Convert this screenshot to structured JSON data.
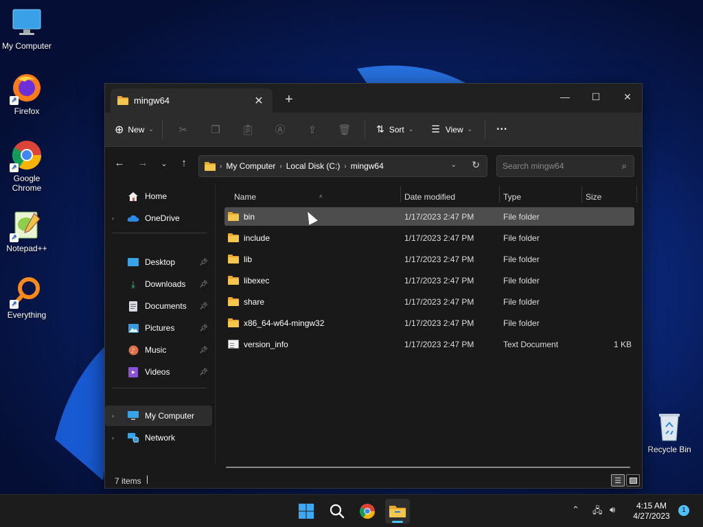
{
  "desktop": {
    "icons": [
      {
        "label": "My Computer"
      },
      {
        "label": "Firefox"
      },
      {
        "label": "Google Chrome"
      },
      {
        "label": "Notepad++"
      },
      {
        "label": "Everything"
      },
      {
        "label": "Recycle Bin"
      }
    ]
  },
  "window": {
    "tab_title": "mingw64",
    "toolbar": {
      "new_label": "New",
      "sort_label": "Sort",
      "view_label": "View",
      "more_label": "···"
    },
    "breadcrumb": [
      "My Computer",
      "Local Disk (C:)",
      "mingw64"
    ],
    "search": {
      "placeholder": "Search mingw64"
    },
    "sidebar": {
      "home": "Home",
      "onedrive": "OneDrive",
      "quick_access": [
        "Desktop",
        "Downloads",
        "Documents",
        "Pictures",
        "Music",
        "Videos"
      ],
      "my_computer": "My Computer",
      "network": "Network"
    },
    "columns": {
      "name": "Name",
      "date": "Date modified",
      "type": "Type",
      "size": "Size"
    },
    "files": [
      {
        "name": "bin",
        "date": "1/17/2023 2:47 PM",
        "type": "File folder",
        "size": "",
        "kind": "folder"
      },
      {
        "name": "include",
        "date": "1/17/2023 2:47 PM",
        "type": "File folder",
        "size": "",
        "kind": "folder"
      },
      {
        "name": "lib",
        "date": "1/17/2023 2:47 PM",
        "type": "File folder",
        "size": "",
        "kind": "folder"
      },
      {
        "name": "libexec",
        "date": "1/17/2023 2:47 PM",
        "type": "File folder",
        "size": "",
        "kind": "folder"
      },
      {
        "name": "share",
        "date": "1/17/2023 2:47 PM",
        "type": "File folder",
        "size": "",
        "kind": "folder"
      },
      {
        "name": "x86_64-w64-mingw32",
        "date": "1/17/2023 2:47 PM",
        "type": "File folder",
        "size": "",
        "kind": "folder"
      },
      {
        "name": "version_info",
        "date": "1/17/2023 2:47 PM",
        "type": "Text Document",
        "size": "1 KB",
        "kind": "document"
      }
    ],
    "status": {
      "count": "7 items"
    }
  },
  "taskbar": {
    "time": "4:15 AM",
    "date": "4/27/2023",
    "notifications": "1"
  },
  "colors": {
    "accent": "#4cc2ff",
    "folder": "#f5c64e",
    "window_bg": "#191919",
    "selected_row": "#4d4d4d"
  }
}
